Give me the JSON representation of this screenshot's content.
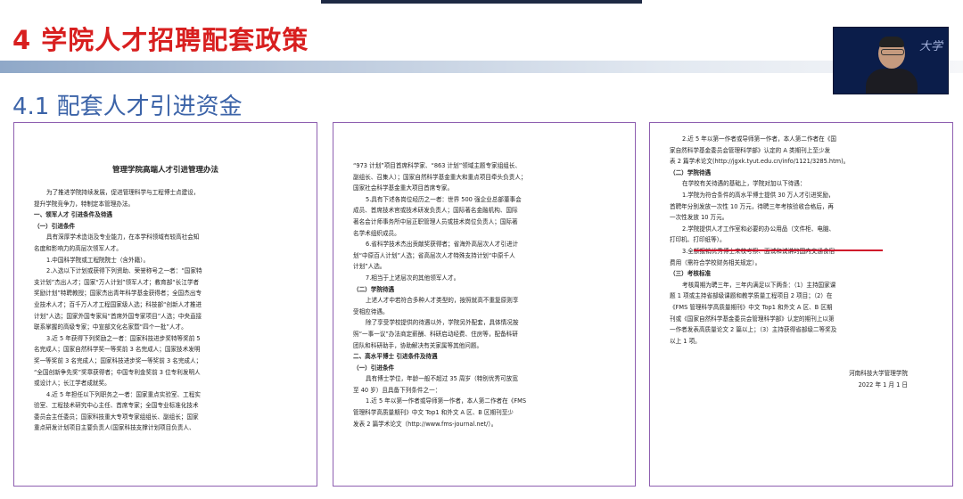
{
  "slide": {
    "heading1": "4 学院人才招聘配套政策",
    "heading2": "4.1 配套人才引进资金"
  },
  "video": {
    "overlay_text": "大学"
  },
  "page1": {
    "title": "管理学院高端人才引进管理办法",
    "lines": [
      "为了推进学院持续发展，促进管理科学与工程博士点建设，",
      "提升学院竞争力，特制定本管理办法。",
      "一、领军人才  引进条件及待遇",
      "（一）引进条件",
      "具有深厚学术造诣及专业能力，在本学科领域有较高社会知",
      "名度和影响力的高层次领军人才。",
      "1.中国科学院或工程院院士（含外籍）。",
      "2.入选以下计划或获得下列资助、荣誉称号之一者：“国家特",
      "支计划”杰出人才；国家“万人计划”领军人才；教育部“长江学者",
      "奖励计划”特聘教授；国家杰出青年科学基金获得者；全国杰出专",
      "业技术人才；百千万人才工程国家级人选；科技部“创新人才推进",
      "计划”人选；国家外国专家局“首席外国专家项目”人选；中央直接",
      "联系掌握的高级专家；中宣部文化名家暨“四个一批”人才。",
      "3.近 5 年获得下列奖励之一者：国家科技进步奖特等奖前 5",
      "名完成人；国家自然科学奖一等奖前 3 名完成人；国家技术发明",
      "奖一等奖前 3 名完成人；国家科技进步奖一等奖前 3 名完成人；",
      "“全国创新争先奖”奖章获得者；中国专利金奖前 3 位专利发明人",
      "或设计人；长江学者成就奖。",
      "4.近 5 年担任以下列职务之一者：国家重点实验室、工程实",
      "验室、工程技术研究中心主任、首席专家；全国专业标准化技术",
      "委员会主任委员；国家科技重大专项专家组组长、副组长；国家",
      "重点研发计划项目主要负责人(国家科技支撑计划项目负责人、"
    ]
  },
  "page2": {
    "lines": [
      "“973 计划”项目首席科学家、“863 计划”领域主题专家组组长、",
      "副组长、召集人）；国家自然科学基金重大和重点项目牵头负责人；",
      "国家社会科学基金重大项目首席专家。",
      "5.具有下述各岗位经历之一者：世界 500 强企业总部董事会",
      "成员、首席技术官或技术研发负责人；国际著名金融机构、国际",
      "著名会计师事务所中层正职管理人员或技术岗位负责人；国际著",
      "名学术组织成员。",
      "6.省科学技术杰出贡献奖获得者；省海外高层次人才引进计",
      "划“中原百人计划”人选；省高层次人才特殊支持计划“中原千人",
      "计划”人选。",
      "7.相当于上述层次的其他领军人才。",
      "（二）学院待遇",
      "上述人才中若符合多种人才类型的，按照就高不重复原则享",
      "受相应待遇。",
      "除了享受学校提供的待遇以外，学院另外配套，具体情况按",
      "照“一事一议”办法商定薪酬、科研启动经费、住房等，配备科研",
      "团队和科研助手，协助解决有关家属等其他问题。",
      "二、高水平博士  引进条件及待遇",
      "（一）引进条件",
      "具有博士学位，年龄一般不超过 35 周岁（特别优秀可放宽",
      "至 40 岁）且具备下列条件之一：",
      "1.近 5 年以第一作者或导师第一作者，本人第二作者在《FMS",
      "管理科学高质量期刊》中文 Top1 和外文 A 区、B 区期刊至少",
      "发表 2 篇学术论文（http://www.fms-journal.net/）。"
    ]
  },
  "page3": {
    "lines": [
      "2.近 5 年以第一作者或导师第一作者，本人第二作者在《国",
      "家自然科学基金委员会管理科学部》认定的 A 类期刊上至少发",
      "表 2 篇学术论文(http://jgxk.tyut.edu.cn/info/1121/3285.htm)。",
      "（二）学院待遇",
      "在学校有关待遇的基础上，学院对加以下待遇：",
      "1.学院为符合条件的高水平博士提供 30 万人才引进奖励，",
      "首聘年分别发放一次性 10 万元，待聘三年考核验收合格后，再",
      "一次性发放 10 万元。",
      "2.学院提供人才工作室和必要的办公用品（文件柜、电脑、",
      "打印机、打印纸等）。",
      "3.全额报销优秀博士来校考察、面试和试讲的国内交通食宿",
      "费用（需符合学校财务相关规定）。",
      "（三）考核标准",
      "考核周期为聘三年，三年内满足以下两条：（1）主持国家课",
      "题 1 项或主持省部级课题和教学质量工程项目 2 项目；（2）在",
      "《FMS 管理科学高质量期刊》中文 Top1 和外文 A 区、B 区期",
      "刊或《国家自然科学基金委员会管理科学部》认定的期刊上以第",
      "一作者发表高质量论文 2 篇以上；（3）主持获得省部级二等奖及",
      "以上 1 项。"
    ],
    "signature": "河南科技大学管理学院",
    "date": "2022 年 1 月 1 日"
  }
}
